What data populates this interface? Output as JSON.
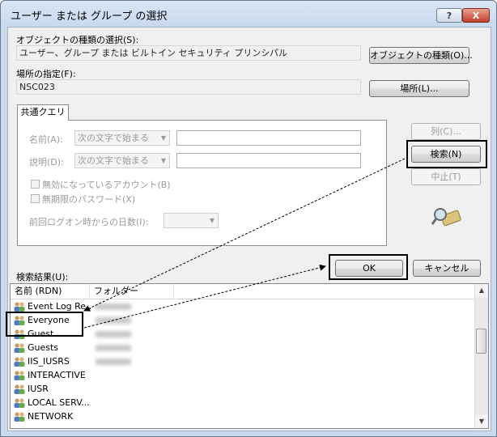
{
  "window": {
    "title": "ユーザー または グループ の選択",
    "help_label": "?",
    "close_label": "X"
  },
  "object_types": {
    "label": "オブジェクトの種類の選択(S):",
    "value": "ユーザー、グループ または ビルトイン セキュリティ プリンシパル",
    "button": "オブジェクトの種類(O)..."
  },
  "location": {
    "label": "場所の指定(F):",
    "value": "NSC023",
    "button": "場所(L)..."
  },
  "query": {
    "tab": "共通クエリ",
    "name_label": "名前(A):",
    "name_mode": "次の文字で始まる",
    "desc_label": "説明(D):",
    "desc_mode": "次の文字で始まる",
    "disabled_accounts": "無効になっているアカウント(B)",
    "no_expire_pw": "無期限のパスワード(X)",
    "days_label": "前回ログオン時からの日数(I):"
  },
  "buttons": {
    "columns": "列(C)...",
    "search": "検索(N)",
    "stop": "中止(T)",
    "ok": "OK",
    "cancel": "キャンセル"
  },
  "results": {
    "label": "検索結果(U):",
    "columns": [
      "名前 (RDN)",
      "フォルダー"
    ],
    "rows": [
      {
        "name": "Event Log Re..."
      },
      {
        "name": "Everyone"
      },
      {
        "name": "Guest"
      },
      {
        "name": "Guests"
      },
      {
        "name": "IIS_IUSRS"
      },
      {
        "name": "INTERACTIVE"
      },
      {
        "name": "IUSR"
      },
      {
        "name": "LOCAL SERV..."
      },
      {
        "name": "NETWORK"
      }
    ]
  }
}
